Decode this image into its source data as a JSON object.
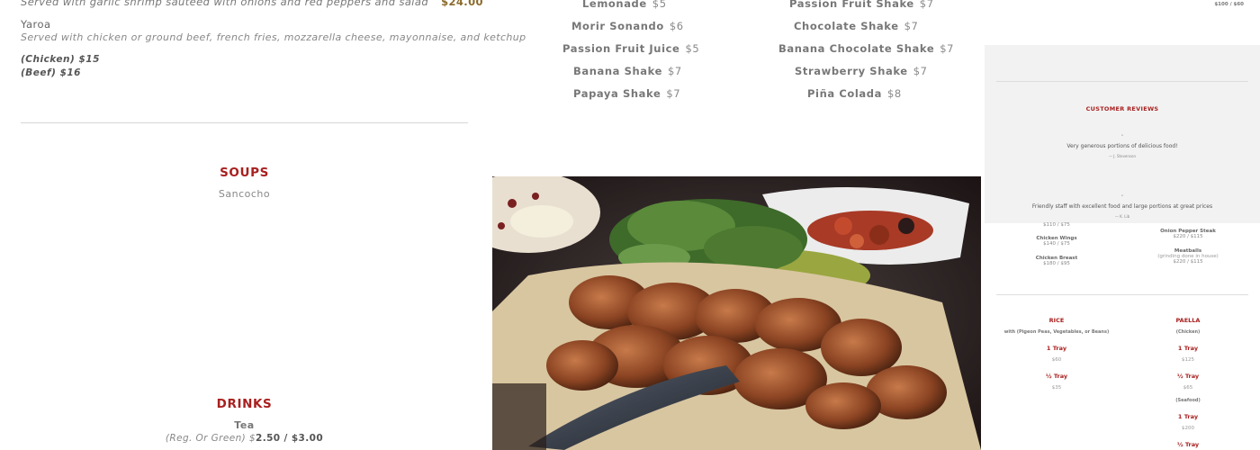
{
  "left": {
    "top_item_desc": "Served with garlic shrimp sauteed with onions and red peppers and salad",
    "top_item_price": "$24.00",
    "yaroa": {
      "name": "Yaroa",
      "desc": "Served with chicken or ground beef, french fries, mozzarella cheese, mayonnaise, and ketchup",
      "chicken": "(Chicken) $15",
      "beef": "(Beef) $16"
    },
    "soups": {
      "title": "SOUPS",
      "item": "Sancocho"
    },
    "drinks": {
      "title": "DRINKS",
      "tea": "Tea",
      "tea_note": "(Reg. Or Green) $",
      "tea_price": "2.50 / $3.00"
    }
  },
  "drinks_list": {
    "col1": [
      {
        "name": "Lemonade",
        "price": "$5"
      },
      {
        "name": "Morir Sonando",
        "price": "$6"
      },
      {
        "name": "Passion Fruit Juice",
        "price": "$5"
      },
      {
        "name": "Banana Shake",
        "price": "$7"
      },
      {
        "name": "Papaya Shake",
        "price": "$7"
      }
    ],
    "col2": [
      {
        "name": "Passion Fruit Shake",
        "price": "$7"
      },
      {
        "name": "Chocolate Shake",
        "price": "$7"
      },
      {
        "name": "Banana Chocolate Shake",
        "price": "$7"
      },
      {
        "name": "Strawberry Shake",
        "price": "$7"
      },
      {
        "name": "Piña Colada",
        "price": "$8"
      }
    ]
  },
  "right": {
    "top_price": "$100 / $60",
    "reviews": {
      "title": "CUSTOMER REVIEWS",
      "items": [
        {
          "text": "Very generous portions of delicious food!",
          "author": "— J. Stevenson"
        },
        {
          "text": "Friendly staff with excellent food and large portions at great prices",
          "author": "— K. Lib"
        }
      ]
    },
    "catering_left": [
      {
        "name": "",
        "price": "$110 / $75"
      },
      {
        "name": "Chicken Wings",
        "price": "$140 / $75"
      },
      {
        "name": "Chicken Breast",
        "price": "$180 / $95"
      }
    ],
    "catering_right": [
      {
        "name": "Onion Pepper Steak",
        "price": "$220 / $115"
      },
      {
        "name": "Meatballs",
        "note": "(grinding done in house)",
        "price": "$220 / $115"
      }
    ],
    "rice": {
      "title": "RICE",
      "sub": "with (Pigeon Peas, Vegetables, or Beans)",
      "trays": [
        {
          "label": "1 Tray",
          "price": "$60"
        },
        {
          "label": "½ Tray",
          "price": "$35"
        }
      ]
    },
    "paella": {
      "title": "PAELLA",
      "sub_chicken": "(Chicken)",
      "chicken_trays": [
        {
          "label": "1 Tray",
          "price": "$125"
        },
        {
          "label": "½ Tray",
          "price": "$65"
        }
      ],
      "sub_seafood": "(Seafood)",
      "seafood_trays": [
        {
          "label": "1 Tray",
          "price": "$200"
        },
        {
          "label": "½ Tray",
          "price": ""
        }
      ]
    }
  },
  "photo": {
    "icon": "grilled-chicken-photo"
  },
  "colors": {
    "accent_red": "#a8201f",
    "panel_gray": "#f2f2f2"
  }
}
